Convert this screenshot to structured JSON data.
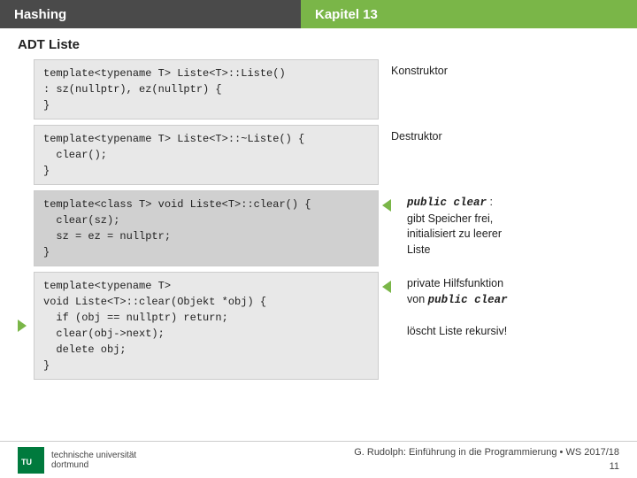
{
  "header": {
    "left": "Hashing",
    "right": "Kapitel 13"
  },
  "page_title": "ADT Liste",
  "sections": [
    {
      "id": "section1",
      "has_arrow": false,
      "arrow_direction": null,
      "code_lines": [
        "template<typename T> Liste<T>::Liste()",
        ": sz(nullptr), ez(nullptr) {",
        "}"
      ],
      "annotation": "Konstruktor",
      "annotation_italic": null,
      "annotation_extra": null
    },
    {
      "id": "section2",
      "has_arrow": false,
      "arrow_direction": null,
      "code_lines": [
        "template<typename T> Liste<T>::~Liste() {",
        "  clear();",
        "}"
      ],
      "annotation": "Destruktor",
      "annotation_italic": null,
      "annotation_extra": null
    },
    {
      "id": "section3",
      "has_arrow": true,
      "arrow_direction": "left",
      "code_lines": [
        "template<class T> void Liste<T>::clear() {",
        "  clear(sz);",
        "  sz = ez = nullptr;",
        "}"
      ],
      "annotation_prefix": "public clear",
      "annotation_prefix_style": "italic-bold",
      "annotation_colon": ":",
      "annotation_lines": [
        "gibt Speicher frei,",
        "initialisiert zu leerer",
        "Liste"
      ]
    },
    {
      "id": "section4",
      "has_arrow": true,
      "arrow_direction": "right-to-left",
      "code_lines": [
        "template<typename T>",
        "void Liste<T>::clear(Objekt *obj) {",
        "  if (obj == nullptr) return;",
        "  clear(obj->next);",
        "  delete obj;",
        "}"
      ],
      "annotation_prefix": "von ",
      "annotation_main": "public clear",
      "annotation_main_style": "italic-bold",
      "annotation_line1": "private Hilfsfunktion",
      "annotation_line2": "löscht Liste rekursiv!"
    }
  ],
  "footer": {
    "institution1": "technische universität",
    "institution2": "dortmund",
    "copyright": "G. Rudolph: Einführung in die Programmierung • WS 2017/18",
    "page": "11"
  }
}
